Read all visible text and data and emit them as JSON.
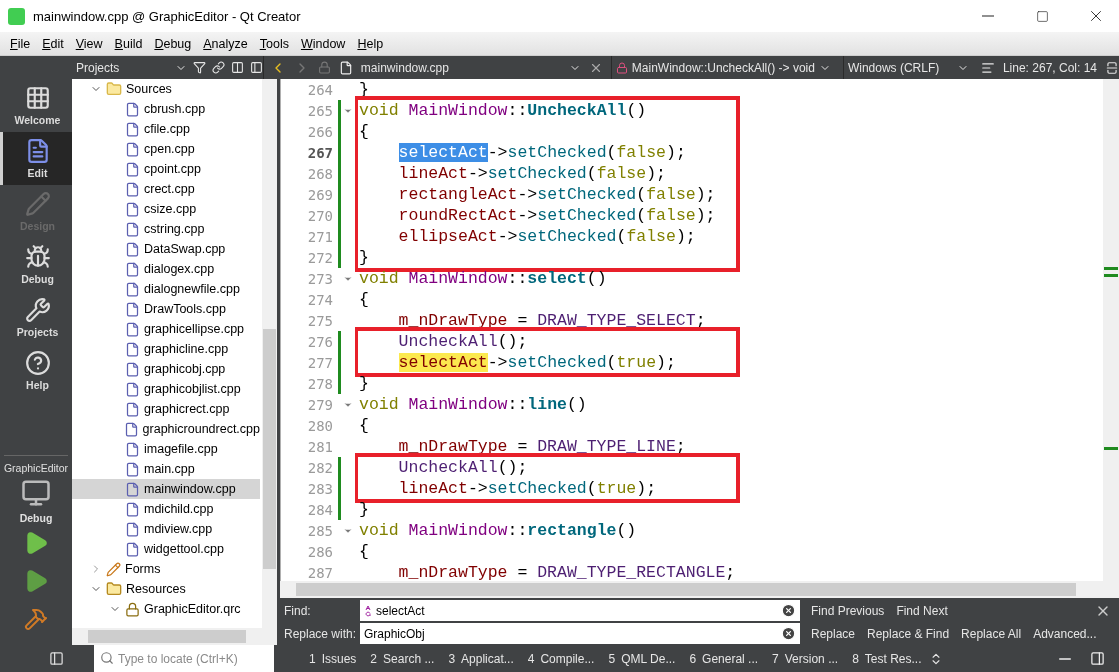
{
  "window": {
    "title": "mainwindow.cpp @ GraphicEditor - Qt Creator"
  },
  "menu": [
    "File",
    "Edit",
    "View",
    "Build",
    "Debug",
    "Analyze",
    "Tools",
    "Window",
    "Help"
  ],
  "modes": [
    {
      "label": "Welcome",
      "kind": "grid",
      "selected": false,
      "disabled": false
    },
    {
      "label": "Edit",
      "kind": "document",
      "selected": true,
      "disabled": false
    },
    {
      "label": "Design",
      "kind": "pencil",
      "selected": false,
      "disabled": true
    },
    {
      "label": "Debug",
      "kind": "bug",
      "selected": false,
      "disabled": false
    },
    {
      "label": "Projects",
      "kind": "wrench",
      "selected": false,
      "disabled": false
    },
    {
      "label": "Help",
      "kind": "help",
      "selected": false,
      "disabled": false
    }
  ],
  "kit": {
    "project": "GraphicEditor",
    "build": "Debug"
  },
  "project_tree": {
    "header": "Projects",
    "items": [
      {
        "label": "Sources",
        "kind": "folder",
        "expanded": true,
        "selected": false,
        "children": [
          {
            "label": "cbrush.cpp",
            "kind": "cpp",
            "selected": false
          },
          {
            "label": "cfile.cpp",
            "kind": "cpp",
            "selected": false
          },
          {
            "label": "cpen.cpp",
            "kind": "cpp",
            "selected": false
          },
          {
            "label": "cpoint.cpp",
            "kind": "cpp",
            "selected": false
          },
          {
            "label": "crect.cpp",
            "kind": "cpp",
            "selected": false
          },
          {
            "label": "csize.cpp",
            "kind": "cpp",
            "selected": false
          },
          {
            "label": "cstring.cpp",
            "kind": "cpp",
            "selected": false
          },
          {
            "label": "DataSwap.cpp",
            "kind": "cpp",
            "selected": false
          },
          {
            "label": "dialogex.cpp",
            "kind": "cpp",
            "selected": false
          },
          {
            "label": "dialognewfile.cpp",
            "kind": "cpp",
            "selected": false
          },
          {
            "label": "DrawTools.cpp",
            "kind": "cpp",
            "selected": false
          },
          {
            "label": "graphicellipse.cpp",
            "kind": "cpp",
            "selected": false
          },
          {
            "label": "graphicline.cpp",
            "kind": "cpp",
            "selected": false
          },
          {
            "label": "graphicobj.cpp",
            "kind": "cpp",
            "selected": false
          },
          {
            "label": "graphicobjlist.cpp",
            "kind": "cpp",
            "selected": false
          },
          {
            "label": "graphicrect.cpp",
            "kind": "cpp",
            "selected": false
          },
          {
            "label": "graphicroundrect.cpp",
            "kind": "cpp",
            "selected": false
          },
          {
            "label": "imagefile.cpp",
            "kind": "cpp",
            "selected": false
          },
          {
            "label": "main.cpp",
            "kind": "cpp",
            "selected": false
          },
          {
            "label": "mainwindow.cpp",
            "kind": "cpp",
            "selected": true
          },
          {
            "label": "mdichild.cpp",
            "kind": "cpp",
            "selected": false
          },
          {
            "label": "mdiview.cpp",
            "kind": "cpp",
            "selected": false
          },
          {
            "label": "widgettool.cpp",
            "kind": "cpp",
            "selected": false
          }
        ]
      },
      {
        "label": "Forms",
        "kind": "forms",
        "expanded": false,
        "selected": false
      },
      {
        "label": "Resources",
        "kind": "resources",
        "expanded": true,
        "selected": false,
        "children": [
          {
            "label": "GraphicEditor.qrc",
            "kind": "qrc",
            "expanded": true,
            "selected": false
          }
        ]
      }
    ]
  },
  "editor_toolbar": {
    "file": "mainwindow.cpp",
    "symbol": "MainWindow::UncheckAll() -> void",
    "line_ending": "Windows (CRLF)",
    "position": "Line: 267, Col: 14"
  },
  "code": {
    "blocks": [
      {
        "boxed": false,
        "lines": [
          {
            "number": "264",
            "current": false,
            "modified": false,
            "foldable": false,
            "indent": false,
            "tokens": [
              {
                "text": "}",
                "kind": "plain"
              }
            ]
          }
        ]
      },
      {
        "boxed": true,
        "lines": [
          {
            "number": "265",
            "current": false,
            "modified": true,
            "foldable": true,
            "indent": false,
            "tokens": [
              {
                "text": "void",
                "kind": "keyword"
              },
              {
                "text": "MainWindow",
                "kind": "class",
                "gap_before": true
              },
              {
                "text": "::",
                "kind": "plain"
              },
              {
                "text": "UncheckAll",
                "kind": "decl"
              },
              {
                "text": "()",
                "kind": "plain"
              }
            ]
          },
          {
            "number": "266",
            "current": false,
            "modified": true,
            "foldable": false,
            "indent": false,
            "tokens": [
              {
                "text": "{",
                "kind": "plain"
              }
            ]
          },
          {
            "number": "267",
            "current": true,
            "modified": true,
            "foldable": false,
            "indent": true,
            "tokens": [
              {
                "text": "selectAct",
                "kind": "member",
                "selected": true
              },
              {
                "text": "->",
                "kind": "plain"
              },
              {
                "text": "setChecked",
                "kind": "method"
              },
              {
                "text": "(",
                "kind": "plain"
              },
              {
                "text": "false",
                "kind": "keyword"
              },
              {
                "text": ");",
                "kind": "plain"
              }
            ]
          },
          {
            "number": "268",
            "current": false,
            "modified": true,
            "foldable": false,
            "indent": true,
            "tokens": [
              {
                "text": "lineAct",
                "kind": "member"
              },
              {
                "text": "->",
                "kind": "plain"
              },
              {
                "text": "setChecked",
                "kind": "method"
              },
              {
                "text": "(",
                "kind": "plain"
              },
              {
                "text": "false",
                "kind": "keyword"
              },
              {
                "text": ");",
                "kind": "plain"
              }
            ]
          },
          {
            "number": "269",
            "current": false,
            "modified": true,
            "foldable": false,
            "indent": true,
            "tokens": [
              {
                "text": "rectangleAct",
                "kind": "member"
              },
              {
                "text": "->",
                "kind": "plain"
              },
              {
                "text": "setChecked",
                "kind": "method"
              },
              {
                "text": "(",
                "kind": "plain"
              },
              {
                "text": "false",
                "kind": "keyword"
              },
              {
                "text": ");",
                "kind": "plain"
              }
            ]
          },
          {
            "number": "270",
            "current": false,
            "modified": true,
            "foldable": false,
            "indent": true,
            "tokens": [
              {
                "text": "roundRectAct",
                "kind": "member"
              },
              {
                "text": "->",
                "kind": "plain"
              },
              {
                "text": "setChecked",
                "kind": "method"
              },
              {
                "text": "(",
                "kind": "plain"
              },
              {
                "text": "false",
                "kind": "keyword"
              },
              {
                "text": ");",
                "kind": "plain"
              }
            ]
          },
          {
            "number": "271",
            "current": false,
            "modified": true,
            "foldable": false,
            "indent": true,
            "tokens": [
              {
                "text": "ellipseAct",
                "kind": "member"
              },
              {
                "text": "->",
                "kind": "plain"
              },
              {
                "text": "setChecked",
                "kind": "method"
              },
              {
                "text": "(",
                "kind": "plain"
              },
              {
                "text": "false",
                "kind": "keyword"
              },
              {
                "text": ");",
                "kind": "plain"
              }
            ]
          },
          {
            "number": "272",
            "current": false,
            "modified": true,
            "foldable": false,
            "indent": false,
            "tokens": [
              {
                "text": "}",
                "kind": "plain"
              }
            ]
          }
        ]
      },
      {
        "boxed": false,
        "lines": [
          {
            "number": "273",
            "current": false,
            "modified": false,
            "foldable": true,
            "indent": false,
            "tokens": [
              {
                "text": "void",
                "kind": "keyword"
              },
              {
                "text": "MainWindow",
                "kind": "class",
                "gap_before": true
              },
              {
                "text": "::",
                "kind": "plain"
              },
              {
                "text": "select",
                "kind": "decl"
              },
              {
                "text": "()",
                "kind": "plain"
              }
            ]
          },
          {
            "number": "274",
            "current": false,
            "modified": false,
            "foldable": false,
            "indent": false,
            "tokens": [
              {
                "text": "{",
                "kind": "plain"
              }
            ]
          },
          {
            "number": "275",
            "current": false,
            "modified": false,
            "foldable": false,
            "indent": true,
            "tokens": [
              {
                "text": "m_nDrawType",
                "kind": "member"
              },
              {
                "text": "=",
                "kind": "plain",
                "gap_before": true
              },
              {
                "text": "DRAW_TYPE_SELECT",
                "kind": "enum",
                "gap_before": true
              },
              {
                "text": ";",
                "kind": "plain"
              }
            ]
          }
        ]
      },
      {
        "boxed": true,
        "lines": [
          {
            "number": "276",
            "current": false,
            "modified": true,
            "foldable": false,
            "indent": true,
            "tokens": [
              {
                "text": "UncheckAll",
                "kind": "call"
              },
              {
                "text": "();",
                "kind": "plain"
              }
            ]
          },
          {
            "number": "277",
            "current": false,
            "modified": true,
            "foldable": false,
            "indent": true,
            "tokens": [
              {
                "text": "selectAct",
                "kind": "member",
                "search_match": true
              },
              {
                "text": "->",
                "kind": "plain"
              },
              {
                "text": "setChecked",
                "kind": "method"
              },
              {
                "text": "(",
                "kind": "plain"
              },
              {
                "text": "true",
                "kind": "keyword"
              },
              {
                "text": ");",
                "kind": "plain"
              }
            ]
          }
        ]
      },
      {
        "boxed": false,
        "lines": [
          {
            "number": "278",
            "current": false,
            "modified": true,
            "foldable": false,
            "indent": false,
            "tokens": [
              {
                "text": "}",
                "kind": "plain"
              }
            ]
          },
          {
            "number": "279",
            "current": false,
            "modified": false,
            "foldable": true,
            "indent": false,
            "tokens": [
              {
                "text": "void",
                "kind": "keyword"
              },
              {
                "text": "MainWindow",
                "kind": "class",
                "gap_before": true
              },
              {
                "text": "::",
                "kind": "plain"
              },
              {
                "text": "line",
                "kind": "decl"
              },
              {
                "text": "()",
                "kind": "plain"
              }
            ]
          },
          {
            "number": "280",
            "current": false,
            "modified": false,
            "foldable": false,
            "indent": false,
            "tokens": [
              {
                "text": "{",
                "kind": "plain"
              }
            ]
          },
          {
            "number": "281",
            "current": false,
            "modified": false,
            "foldable": false,
            "indent": true,
            "tokens": [
              {
                "text": "m_nDrawType",
                "kind": "member"
              },
              {
                "text": "=",
                "kind": "plain",
                "gap_before": true
              },
              {
                "text": "DRAW_TYPE_LINE",
                "kind": "enum",
                "gap_before": true
              },
              {
                "text": ";",
                "kind": "plain"
              }
            ]
          }
        ]
      },
      {
        "boxed": true,
        "lines": [
          {
            "number": "282",
            "current": false,
            "modified": true,
            "foldable": false,
            "indent": true,
            "tokens": [
              {
                "text": "UncheckAll",
                "kind": "call"
              },
              {
                "text": "();",
                "kind": "plain"
              }
            ]
          },
          {
            "number": "283",
            "current": false,
            "modified": true,
            "foldable": false,
            "indent": true,
            "tokens": [
              {
                "text": "lineAct",
                "kind": "member"
              },
              {
                "text": "->",
                "kind": "plain"
              },
              {
                "text": "setChecked",
                "kind": "method"
              },
              {
                "text": "(",
                "kind": "plain"
              },
              {
                "text": "true",
                "kind": "keyword"
              },
              {
                "text": ");",
                "kind": "plain"
              }
            ]
          }
        ]
      },
      {
        "boxed": false,
        "lines": [
          {
            "number": "284",
            "current": false,
            "modified": true,
            "foldable": false,
            "indent": false,
            "tokens": [
              {
                "text": "}",
                "kind": "plain"
              }
            ]
          },
          {
            "number": "285",
            "current": false,
            "modified": false,
            "foldable": true,
            "indent": false,
            "tokens": [
              {
                "text": "void",
                "kind": "keyword"
              },
              {
                "text": "MainWindow",
                "kind": "class",
                "gap_before": true
              },
              {
                "text": "::",
                "kind": "plain"
              },
              {
                "text": "rectangle",
                "kind": "decl"
              },
              {
                "text": "()",
                "kind": "plain"
              }
            ]
          },
          {
            "number": "286",
            "current": false,
            "modified": false,
            "foldable": false,
            "indent": false,
            "tokens": [
              {
                "text": "{",
                "kind": "plain"
              }
            ]
          },
          {
            "number": "287",
            "current": false,
            "modified": false,
            "foldable": false,
            "indent": true,
            "tokens": [
              {
                "text": "m_nDrawType",
                "kind": "member"
              },
              {
                "text": "=",
                "kind": "plain",
                "gap_before": true
              },
              {
                "text": "DRAW_TYPE_RECTANGLE",
                "kind": "enum",
                "gap_before": true
              },
              {
                "text": ";",
                "kind": "plain"
              }
            ]
          }
        ]
      }
    ]
  },
  "find_bar": {
    "find_label": "Find:",
    "find_value": "selectAct",
    "replace_label": "Replace with:",
    "replace_value": "GraphicObj",
    "find_buttons": [
      "Find Previous",
      "Find Next"
    ],
    "replace_buttons": [
      "Replace",
      "Replace & Find",
      "Replace All",
      "Advanced..."
    ]
  },
  "status_bar": {
    "locate_placeholder": "Type to locate (Ctrl+K)",
    "panes": [
      {
        "number": "1",
        "label": "Issues"
      },
      {
        "number": "2",
        "label": "Search ..."
      },
      {
        "number": "3",
        "label": "Applicat..."
      },
      {
        "number": "4",
        "label": "Compile..."
      },
      {
        "number": "5",
        "label": "QML De..."
      },
      {
        "number": "6",
        "label": "General ..."
      },
      {
        "number": "7",
        "label": "Version ..."
      },
      {
        "number": "8",
        "label": "Test Res..."
      }
    ]
  }
}
